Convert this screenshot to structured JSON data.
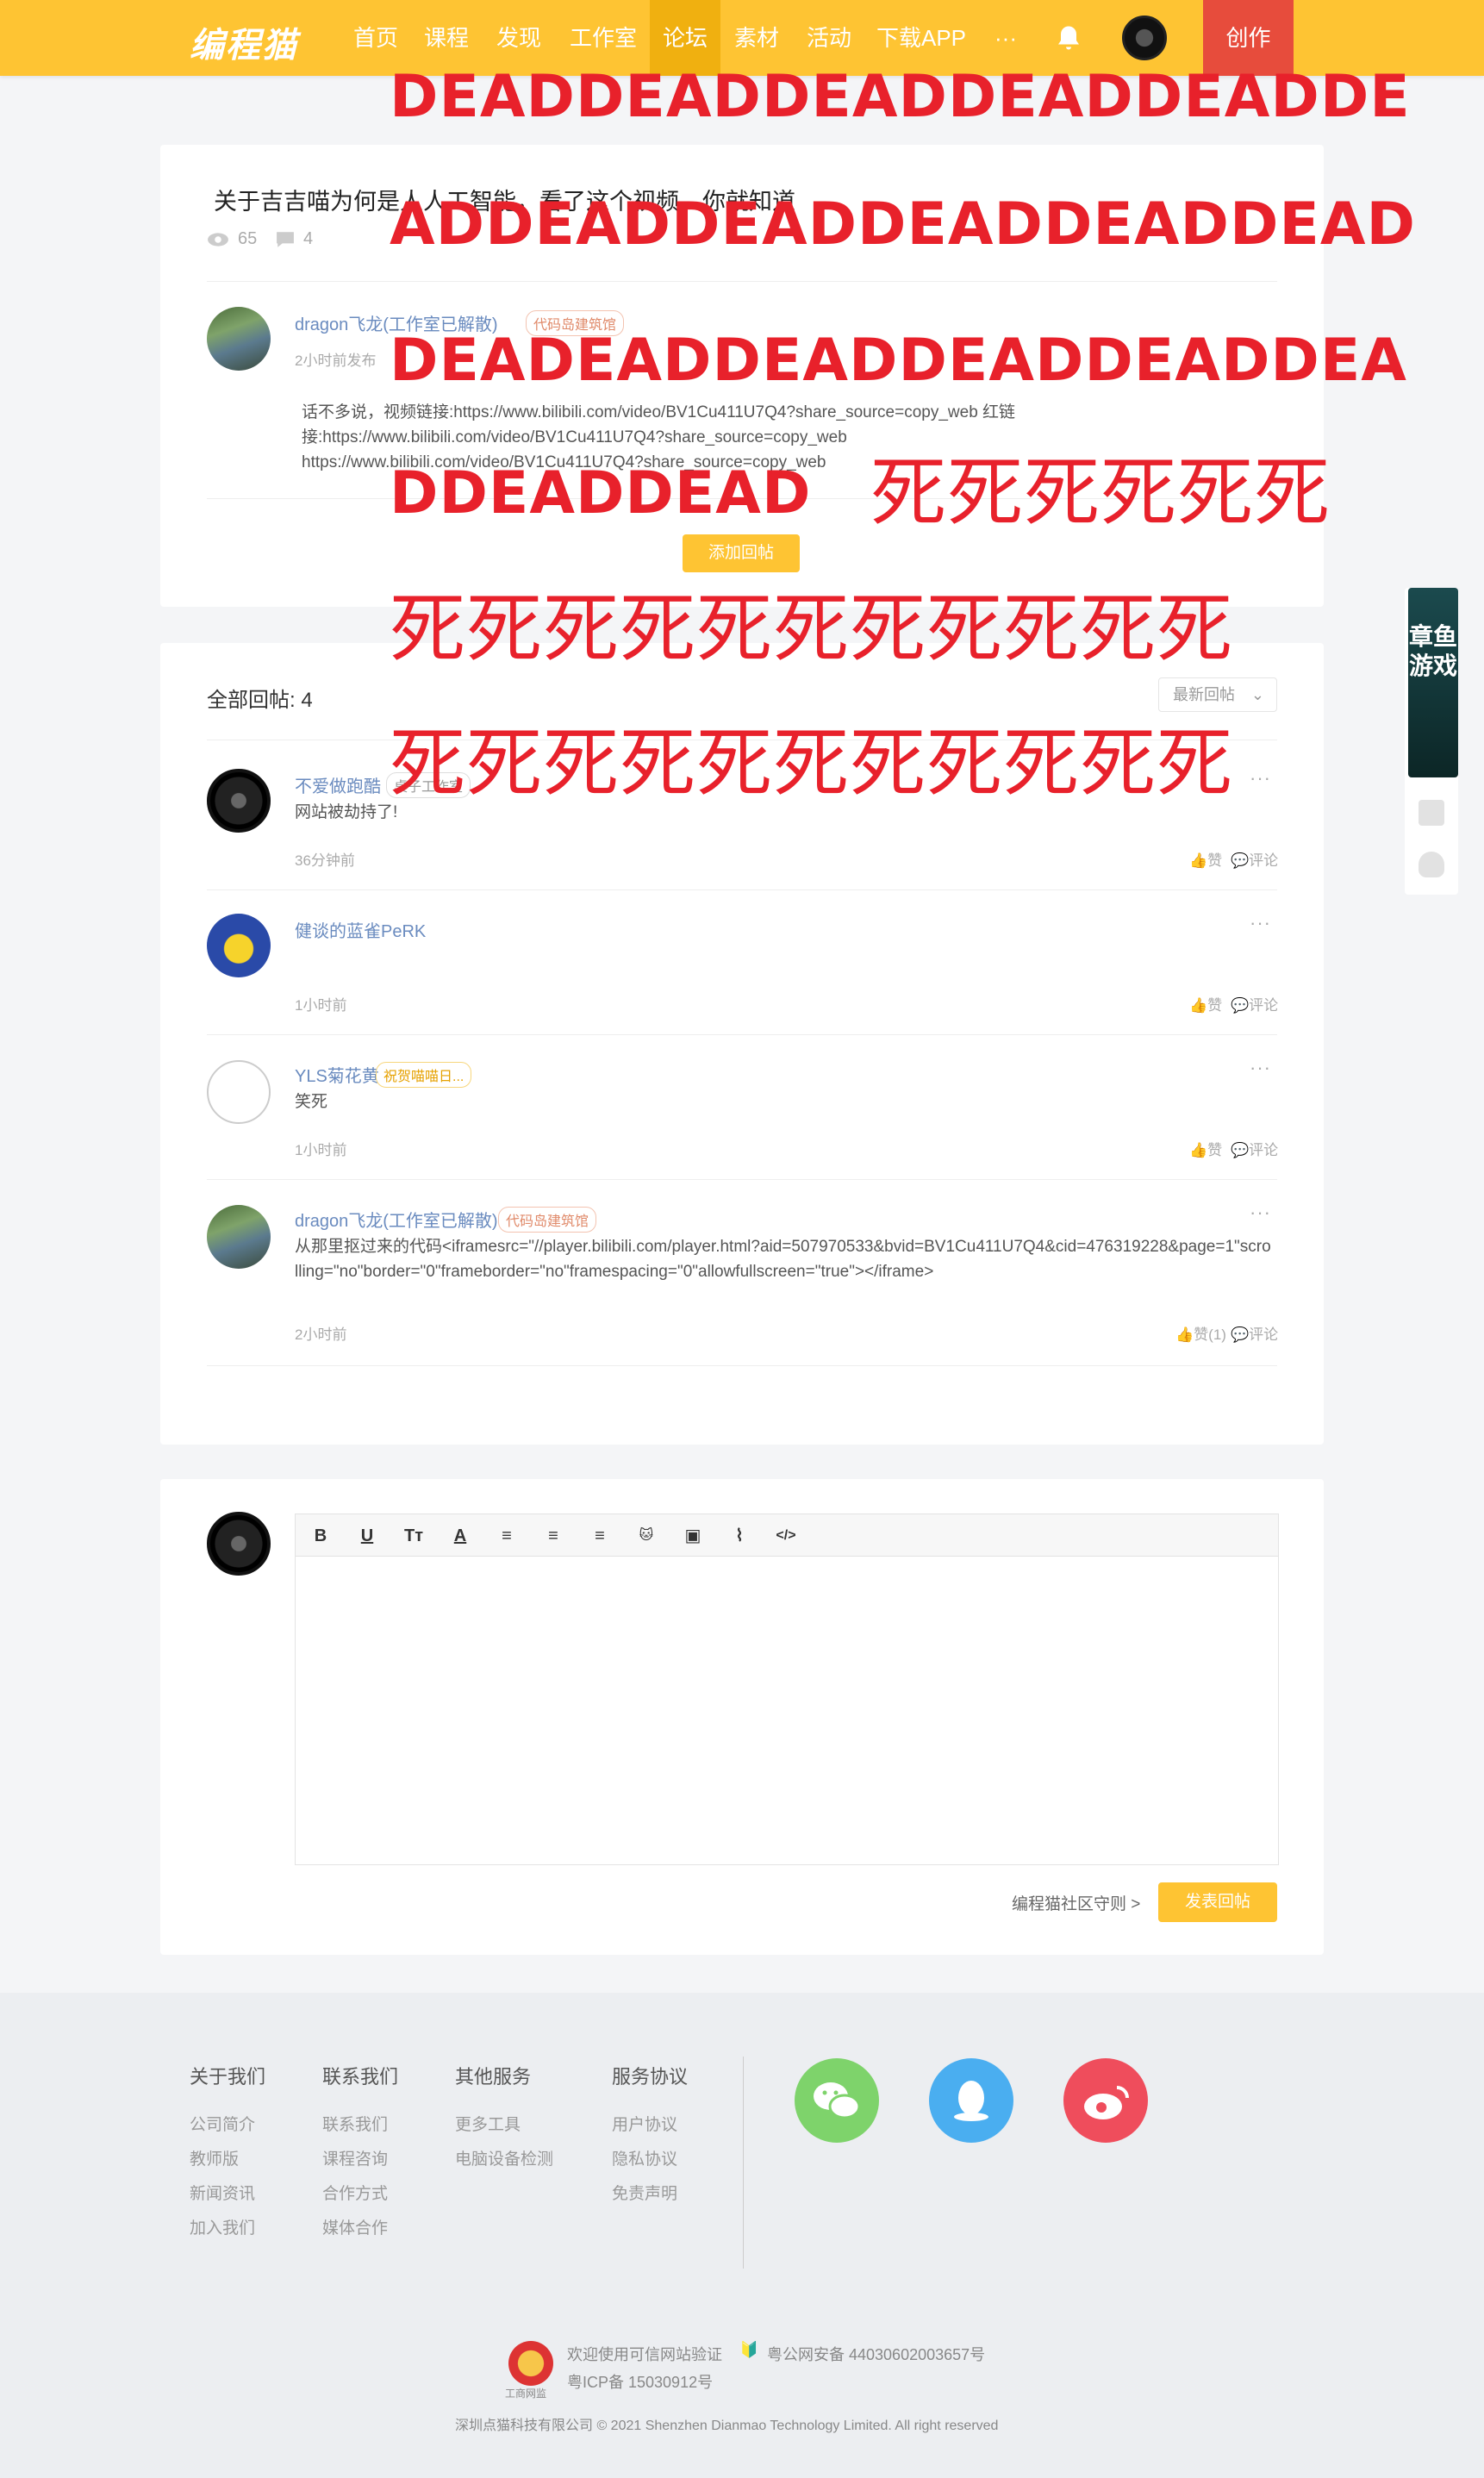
{
  "nav": {
    "logo": "编程猫",
    "items": [
      "首页",
      "课程",
      "发现",
      "工作室",
      "论坛",
      "素材",
      "活动",
      "下载APP"
    ],
    "more": "···",
    "create": "创作"
  },
  "post": {
    "title": "关于吉吉喵为何是人人工智能，看了这个视频，你就知道",
    "views": "65",
    "comments": "4",
    "author": {
      "name": "dragon飞龙(工作室已解散)",
      "badge": "代码岛建筑馆",
      "time": "2小时前发布"
    },
    "body": "话不多说，视频链接:https://www.bilibili.com/video/BV1Cu411U7Q4?share_source=copy_web 红链接:https://www.bilibili.com/video/BV1Cu411U7Q4?share_source=copy_web https://www.bilibili.com/video/BV1Cu411U7Q4?share_source=copy_web",
    "reply_button": "添加回帖"
  },
  "replies_section": {
    "title": "全部回帖: 4",
    "sort": "最新回帖"
  },
  "replies": [
    {
      "name": "不爱做跑酷",
      "badge": "桌子工作室",
      "text": "网站被劫持了!",
      "time": "36分钟前",
      "like": "赞",
      "comment": "评论"
    },
    {
      "name": "健谈的蓝雀PeRK",
      "badge": "",
      "text": "",
      "time": "1小时前",
      "like": "赞",
      "comment": "评论"
    },
    {
      "name": "YLS菊花黄",
      "badge": "祝贺喵喵日...",
      "text": "笑死",
      "time": "1小时前",
      "like": "赞",
      "comment": "评论"
    },
    {
      "name": "dragon飞龙(工作室已解散)",
      "badge": "代码岛建筑馆",
      "text": "从那里抠过来的代码<iframesrc=\"//player.bilibili.com/player.html?aid=507970533&bvid=BV1Cu411U7Q4&cid=476319228&page=1\"scrolling=\"no\"border=\"0\"frameborder=\"no\"framespacing=\"0\"allowfullscreen=\"true\"></iframe>",
      "time": "2小时前",
      "like": "赞(1)",
      "comment": "评论"
    }
  ],
  "editor": {
    "tools": [
      "B",
      "U",
      "Tт",
      "A",
      "≡",
      "≡",
      "≡",
      "🐱",
      "▣",
      "⌇",
      "</>"
    ],
    "rules": "编程猫社区守则 >",
    "submit": "发表回帖"
  },
  "footer": {
    "columns": [
      {
        "title": "关于我们",
        "links": [
          "公司简介",
          "教师版",
          "新闻资讯",
          "加入我们"
        ]
      },
      {
        "title": "联系我们",
        "links": [
          "联系我们",
          "课程咨询",
          "合作方式",
          "媒体合作"
        ]
      },
      {
        "title": "其他服务",
        "links": [
          "更多工具",
          "电脑设备检测"
        ]
      },
      {
        "title": "服务协议",
        "links": [
          "用户协议",
          "隐私协议",
          "免责声明"
        ]
      }
    ],
    "social": [
      {
        "icon": "wechat-icon",
        "color": "#7ed36b"
      },
      {
        "icon": "qq-icon",
        "color": "#4aaef0"
      },
      {
        "icon": "weibo-icon",
        "color": "#ef4d5c"
      }
    ],
    "verify": "欢迎使用可信网站验证",
    "police": "粤公网安备 44030602003657号",
    "icp": "粤ICP备 15030912号",
    "emblem_label": "工商网监",
    "copyright": "深圳点猫科技有限公司   © 2021 Shenzhen Dianmao Technology Limited. All right reserved"
  },
  "side": {
    "game": "章鱼游戏"
  },
  "overlay": {
    "row1": "DEADDEADDEADDEADDEADDE",
    "row2": "ADDEADDEADDEADDEADDEAD",
    "row3": "DEADEADDEADDEADDEADDEA",
    "row4a": "DDEADDEAD",
    "row4b": "死死死死死死",
    "row5": "死死死死死死死死死死死",
    "row6": "死死死死死死死死死死死"
  },
  "colors": {
    "brand": "#fec433",
    "create": "#e74c3c",
    "overlay": "#e8212b"
  }
}
